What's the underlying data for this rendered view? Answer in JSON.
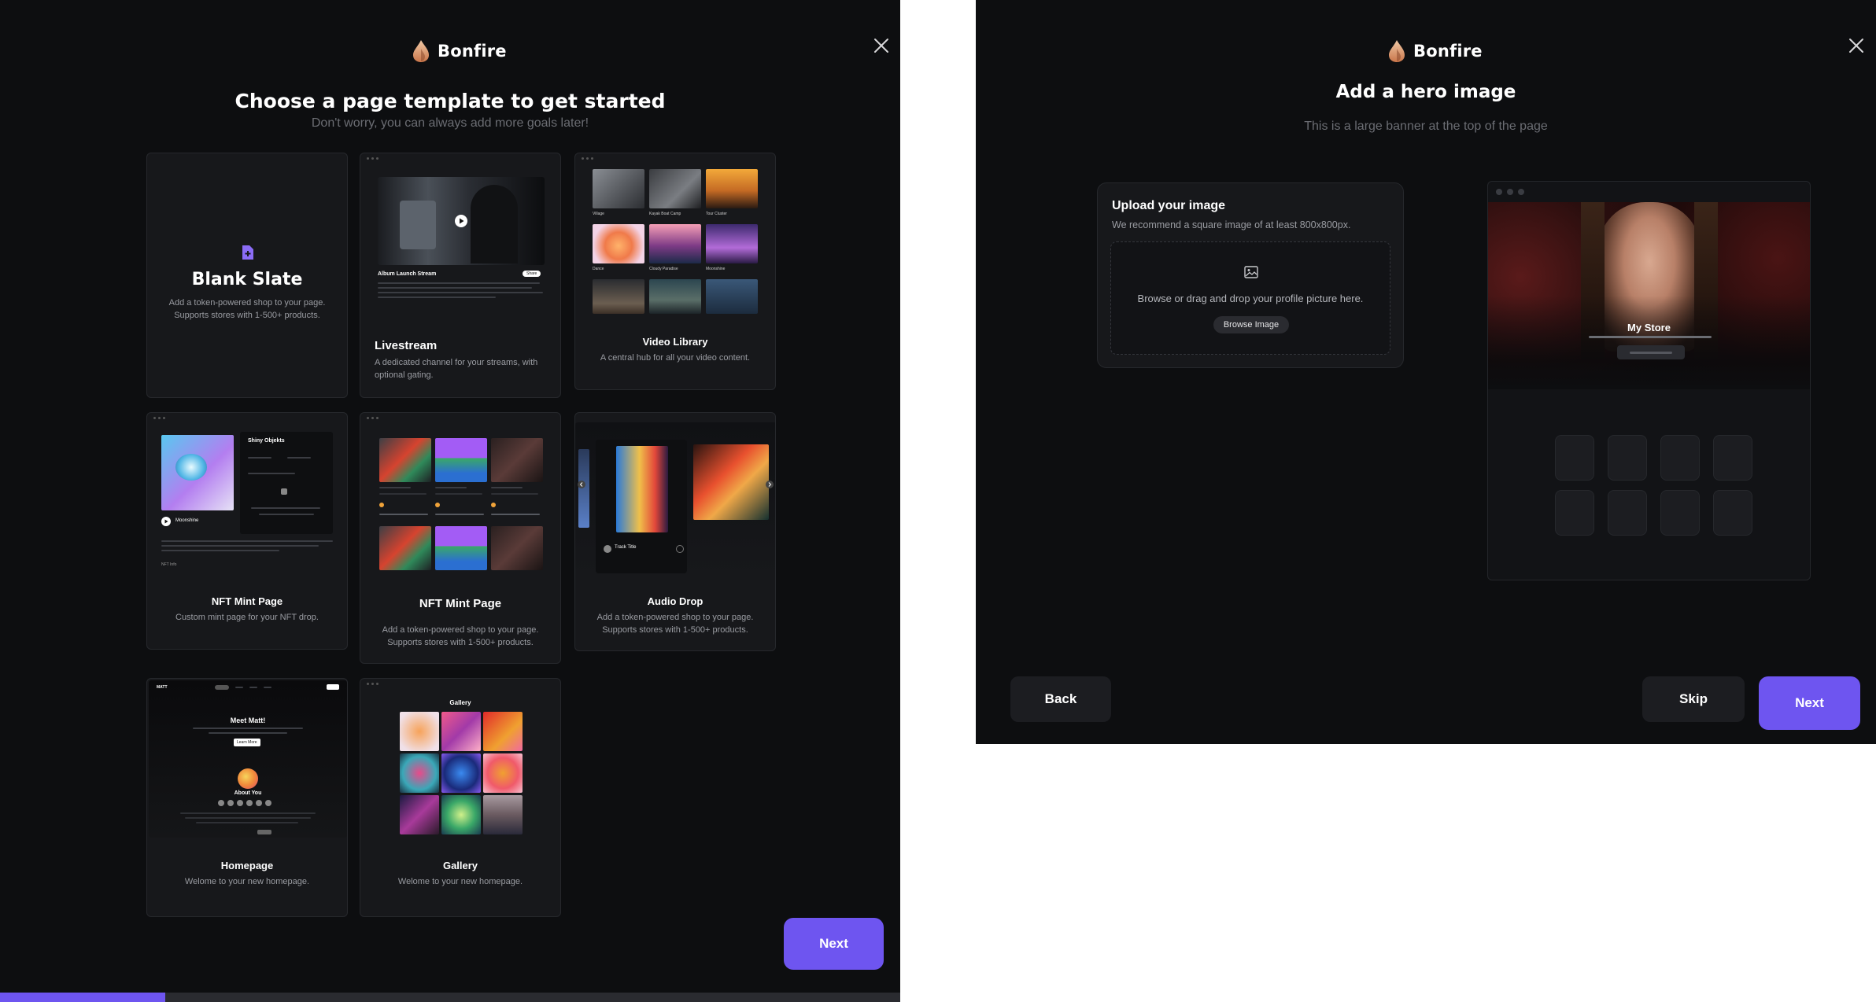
{
  "colors": {
    "accent": "#6e55f0",
    "background": "#0d0e10",
    "card": "#17181b",
    "muted_text": "#6b6d73"
  },
  "left": {
    "brand": "Bonfire",
    "close_icon": "close-icon",
    "title": "Choose a page template to get started",
    "subtitle": "Don't worry, you can always add more goals later!",
    "templates": [
      {
        "title": "Blank Slate",
        "desc": "Add a token-powered shop to your page. Supports stores with 1-500+ products."
      },
      {
        "title": "Livestream",
        "desc": "A dedicated channel for your streams, with optional gating.",
        "thumb_caption": "Album Launch Stream",
        "thumb_badge": "Share"
      },
      {
        "title": "Video Library",
        "desc": "A central hub for all your video content.",
        "thumb_labels": [
          "Village",
          "Kayak Boat Camp",
          "Tour Cluster",
          "Dance",
          "Cloudy Paradise",
          "Moonshine"
        ]
      },
      {
        "title": "NFT Mint Page",
        "desc": "Custom mint page for your NFT drop.",
        "thumb_heading": "Shiny Objekts",
        "thumb_artist": "Moonshine",
        "thumb_section": "NFT Info"
      },
      {
        "title": "NFT Mint Page",
        "desc": "Add a token-powered shop to your page. Supports stores with 1-500+ products."
      },
      {
        "title": "Audio Drop",
        "desc": "Add a token-powered shop to your page. Supports stores with 1-500+ products.",
        "thumb_track": "Track Title"
      },
      {
        "title": "Homepage",
        "desc": "Welome to your new homepage.",
        "thumb_logo": "MATT",
        "thumb_hero": "Meet Matt!",
        "thumb_button": "Learn More",
        "thumb_about": "About You"
      },
      {
        "title": "Gallery",
        "desc": "Welome to your new homepage.",
        "thumb_heading": "Gallery"
      }
    ],
    "next_label": "Next",
    "progress": 0.184
  },
  "right": {
    "brand": "Bonfire",
    "close_icon": "close-icon",
    "title": "Add a hero image",
    "subtitle": "This is a large banner at the top of the page",
    "upload": {
      "title": "Upload your image",
      "subtitle": "We recommend a square image of at least 800x800px.",
      "icon": "image-icon",
      "drop_text": "Browse or drag and drop your profile picture here.",
      "browse_label": "Browse Image"
    },
    "preview": {
      "store_name": "My Store"
    },
    "back_label": "Back",
    "skip_label": "Skip",
    "next_label": "Next"
  }
}
